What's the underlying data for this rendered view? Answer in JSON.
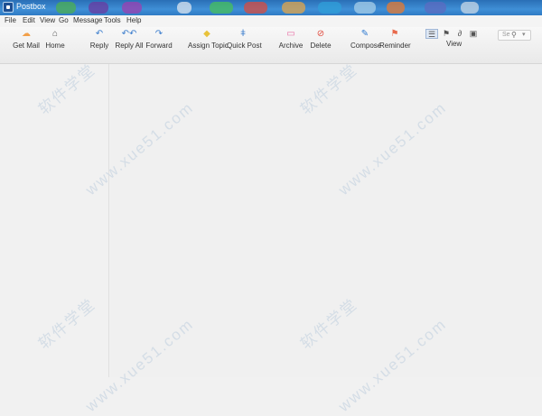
{
  "window": {
    "title": "Postbox"
  },
  "menu": [
    "File",
    "Edit",
    "View",
    "Go",
    "Message",
    "Tools",
    "Help"
  ],
  "toolbar": {
    "buttons": [
      {
        "label": "Get Mail",
        "icon": "get-mail-icon"
      },
      {
        "label": "Home",
        "icon": "home-icon"
      },
      {
        "label": "Reply",
        "icon": "reply-icon"
      },
      {
        "label": "Reply All",
        "icon": "reply-all-icon"
      },
      {
        "label": "Forward",
        "icon": "forward-icon"
      },
      {
        "label": "Assign Topic",
        "icon": "tag-icon"
      },
      {
        "label": "Quick Post",
        "icon": "quick-post-icon"
      },
      {
        "label": "Archive",
        "icon": "archive-icon"
      },
      {
        "label": "Delete",
        "icon": "delete-icon"
      },
      {
        "label": "Compose",
        "icon": "compose-icon"
      },
      {
        "label": "Reminder",
        "icon": "flag-icon"
      }
    ],
    "view_label": "View",
    "search_placeholder": "Se"
  },
  "colors": {
    "title_bar": "#3a84cc",
    "get_mail": "#f2a04a",
    "tag": "#e8c23a",
    "archive": "#e86aa3",
    "delete": "#e04b3e",
    "compose": "#2f7ad0",
    "reminder": "#e86a4d"
  },
  "watermark": [
    "软件学堂",
    "www.xue51.com"
  ]
}
